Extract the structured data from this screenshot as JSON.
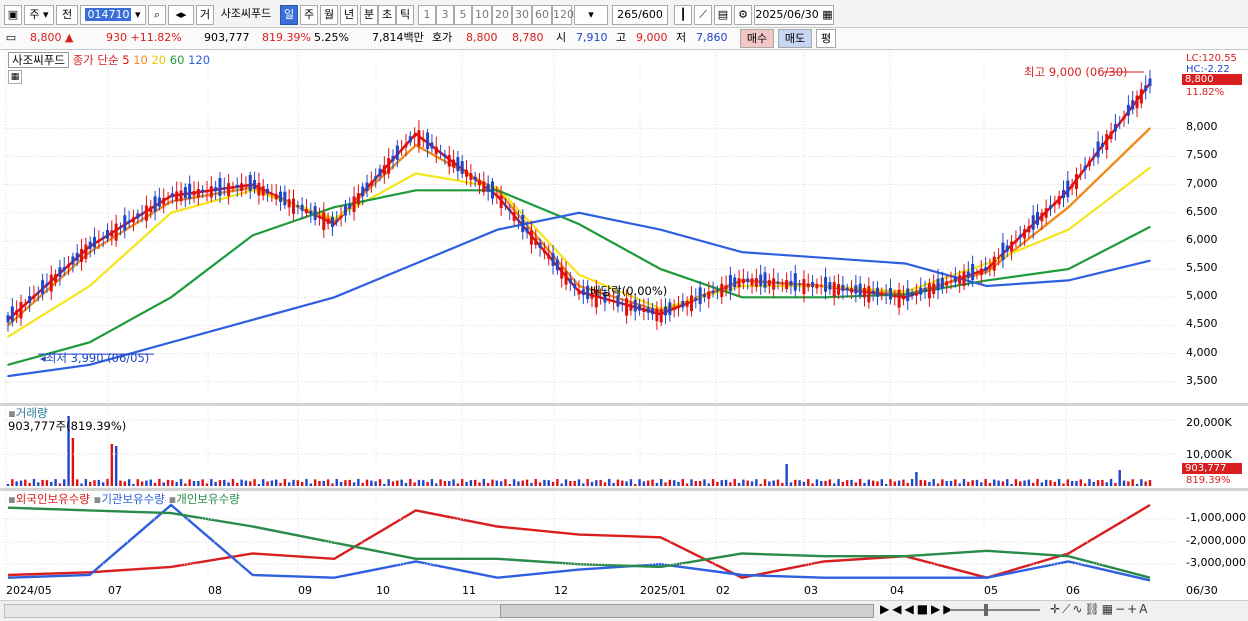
{
  "toolbar": {
    "market": "주",
    "jeon": "전",
    "code": "014710",
    "view_btn": "거",
    "stock_name": "사조씨푸드",
    "periods": [
      "일",
      "주",
      "월",
      "년",
      "분",
      "초",
      "틱"
    ],
    "intervals": [
      "1",
      "3",
      "5",
      "10",
      "20",
      "30",
      "60",
      "120"
    ],
    "count": "265",
    "count_max": "/600",
    "date": "2025/06/30"
  },
  "quote": {
    "price": "8,800",
    "arrow": "▲",
    "change": "930",
    "change_pct": "+11.82%",
    "volume": "903,777",
    "vol_ratio": "819.39%",
    "turnover": "5.25%",
    "amount": "7,814백만",
    "hoga_label": "호가",
    "ask": "8,800",
    "bid": "8,780",
    "open_label": "시",
    "open": "7,910",
    "high_label": "고",
    "high": "9,000",
    "low_label": "저",
    "low": "7,860",
    "buy": "매수",
    "sell": "매도",
    "eval": "평"
  },
  "price_pane": {
    "stock": "사조씨푸드",
    "legend_main": "종가 단순",
    "ma_periods": [
      "5",
      "10",
      "20",
      "60",
      "120"
    ],
    "ma_colors": [
      "#e01010",
      "#f08c1c",
      "#f5e41a",
      "#1f9a3a",
      "#2d5fe0"
    ],
    "high_annot": "최고 9,000 (06/30)",
    "low_annot": "최저 3,990 (06/05)",
    "div_annot": "배당락(0.00%)",
    "lc": "LC:120.55",
    "hc": "HC:-2.22",
    "last_price": "8,800",
    "last_pct": "11.82%",
    "yticks": [
      "8,000",
      "7,500",
      "7,000",
      "6,500",
      "6,000",
      "5,500",
      "5,000",
      "4,500",
      "4,000",
      "3,500"
    ]
  },
  "volume_pane": {
    "title": "거래량",
    "value": "903,777주(819.39%)",
    "yticks": [
      "20,000K",
      "10,000K"
    ],
    "last": "903,777",
    "last_pct": "819.39%"
  },
  "holder_pane": {
    "legends": [
      "외국인보유수량",
      "기관보유수량",
      "개인보유수량"
    ],
    "colors": [
      "#d81e1e",
      "#2d5fe0",
      "#2a8a4a"
    ],
    "yticks": [
      "-1,000,000",
      "-2,000,000",
      "-3,000,000"
    ]
  },
  "xaxis": [
    "2024/05",
    "07",
    "08",
    "09",
    "10",
    "11",
    "12",
    "2025/01",
    "02",
    "03",
    "04",
    "05",
    "06"
  ],
  "xaxis_end": "06/30",
  "chart_data": {
    "type": "line",
    "x_dates": [
      "2024-05",
      "2024-06",
      "2024-07",
      "2024-08",
      "2024-09",
      "2024-10",
      "2024-11",
      "2024-12",
      "2025-01",
      "2025-02",
      "2025-03",
      "2025-04",
      "2025-05",
      "2025-06",
      "2025-06-30"
    ],
    "series": [
      {
        "name": "5",
        "values": [
          4600,
          5900,
          6800,
          7000,
          6300,
          7900,
          6800,
          5100,
          4700,
          5300,
          5200,
          5000,
          5500,
          6900,
          8800
        ]
      },
      {
        "name": "10",
        "values": [
          4500,
          5800,
          6700,
          6950,
          6350,
          7700,
          6900,
          5200,
          4750,
          5300,
          5200,
          5050,
          5450,
          6600,
          8000
        ]
      },
      {
        "name": "20",
        "values": [
          4300,
          5200,
          6500,
          6900,
          6400,
          7200,
          6950,
          5400,
          4800,
          5200,
          5200,
          5100,
          5600,
          6200,
          7300
        ]
      },
      {
        "name": "60",
        "values": [
          3800,
          4200,
          5000,
          6100,
          6600,
          6900,
          6900,
          6300,
          5500,
          5000,
          5000,
          5050,
          5300,
          5500,
          6250
        ]
      },
      {
        "name": "120",
        "values": [
          3600,
          3800,
          4200,
          4600,
          5000,
          5600,
          6200,
          6500,
          6200,
          5800,
          5700,
          5600,
          5200,
          5300,
          5650
        ]
      }
    ],
    "ylim": [
      3300,
      9000
    ],
    "ylabel": "",
    "xlabel": ""
  }
}
